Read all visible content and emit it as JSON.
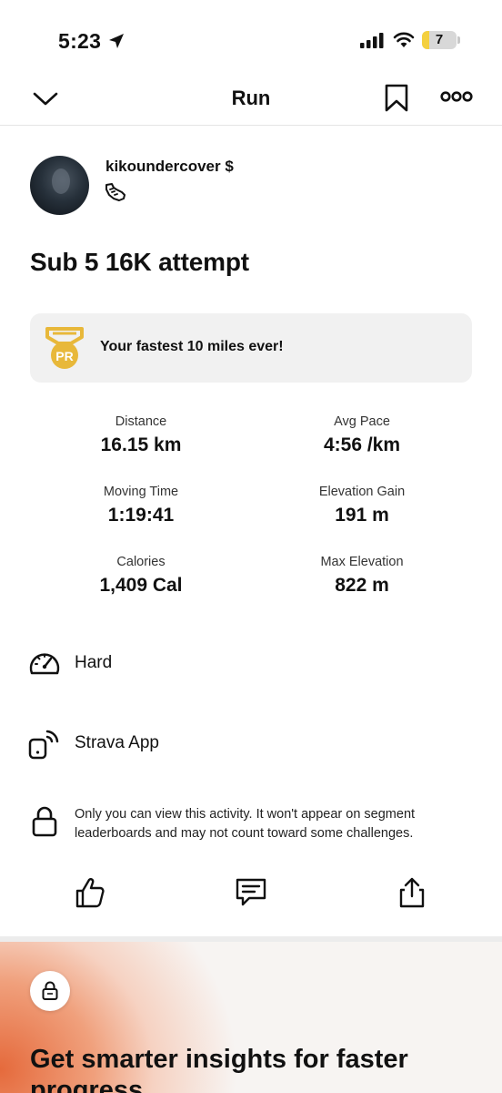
{
  "status_bar": {
    "time": "5:23",
    "battery_level": "7",
    "icons": [
      "location-arrow-icon",
      "signal-icon",
      "wifi-icon",
      "battery-icon"
    ]
  },
  "nav": {
    "title": "Run",
    "icons": [
      "chevron-down-icon",
      "bookmark-icon",
      "more-icon"
    ]
  },
  "athlete": {
    "name": "kikoundercover",
    "subscriber_badge": "$",
    "activity_type_icon": "shoe-icon"
  },
  "activity": {
    "title": "Sub 5 16K attempt"
  },
  "pr_banner": {
    "icon": "pr-medal-icon",
    "medal_text": "PR",
    "text": "Your fastest 10 miles ever!"
  },
  "stats": [
    {
      "label": "Distance",
      "value": "16.15 km"
    },
    {
      "label": "Avg Pace",
      "value": "4:56 /km"
    },
    {
      "label": "Moving Time",
      "value": "1:19:41"
    },
    {
      "label": "Elevation Gain",
      "value": "191 m"
    },
    {
      "label": "Calories",
      "value": "1,409 Cal"
    },
    {
      "label": "Max Elevation",
      "value": "822 m"
    }
  ],
  "perceived_exertion": {
    "icon": "gauge-icon",
    "label": "Hard"
  },
  "device": {
    "icon": "phone-broadcast-icon",
    "label": "Strava App"
  },
  "privacy": {
    "icon": "lock-icon",
    "text": "Only you can view this activity. It won't appear on segment leaderboards and may not count toward some challenges."
  },
  "actions": [
    "thumbs-up-icon",
    "comment-icon",
    "share-icon"
  ],
  "promo": {
    "icon": "lock-icon",
    "title": "Get smarter insights for faster progress"
  },
  "colors": {
    "accent_orange": "#e56a3c",
    "pr_gold": "#e8b83a",
    "banner_bg": "#f1f1f1"
  }
}
